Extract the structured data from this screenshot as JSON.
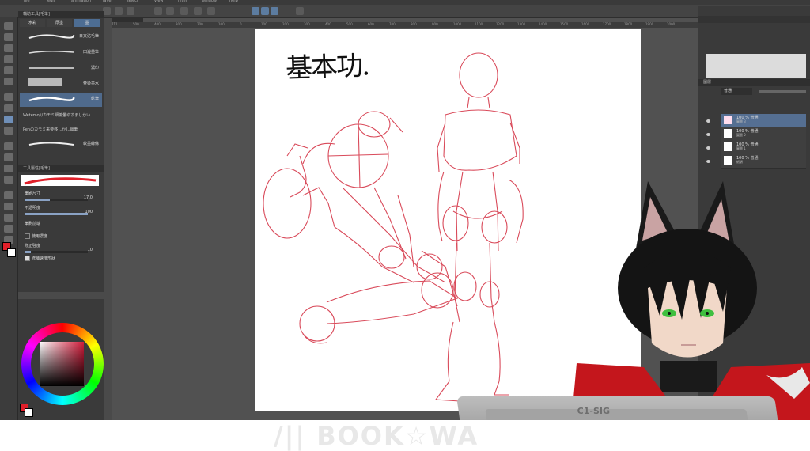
{
  "menu": {
    "items": [
      "file",
      "edit",
      "animation",
      "layer",
      "select",
      "view",
      "filter",
      "window",
      "help"
    ]
  },
  "subtool": {
    "header": "輔助工具[毛筆]",
    "tabs": [
      "水彩",
      "厚塗",
      "墨"
    ],
    "brushes": [
      {
        "label": "日文沾毛筆"
      },
      {
        "label": "田邊墨筆"
      },
      {
        "label": "濃印"
      },
      {
        "label": "暈染墨水"
      },
      {
        "label": "乾筆"
      },
      {
        "label": "Wetemoji毛筆 (細擦暈)",
        "long": "Wetemoji/カモミ細擦暈ゆすましかい"
      },
      {
        "label": "Pen",
        "long": "Penのカモミ来要移しかし細筆"
      },
      {
        "label": "軟墨線條"
      }
    ]
  },
  "toolprop": {
    "header": "工具屬性[毛筆]",
    "brush_size_label": "筆刷尺寸",
    "brush_size_value": "17.0",
    "opacity_label": "不透明度",
    "opacity_value": "100",
    "brush_shape_label": "筆刷前端",
    "anti_alias_label": "使用濃度",
    "stabilize_label": "修正強度",
    "stabilize_value": "10",
    "vector_label": "修補速度形狀"
  },
  "colors": {
    "main": "#e0202a",
    "sub": "#ffffff",
    "accent": "#5c7ca0"
  },
  "ruler": {
    "ticks": [
      "711",
      "500",
      "400",
      "300",
      "200",
      "100",
      "0",
      "100",
      "200",
      "300",
      "400",
      "500",
      "600",
      "700",
      "800",
      "900",
      "1000",
      "1100",
      "1200",
      "1300",
      "1400",
      "1500",
      "1600",
      "1700",
      "1800",
      "1900",
      "2000"
    ]
  },
  "canvas": {
    "title_text": "基本功."
  },
  "layers": {
    "header": "圖層",
    "blend": "普通",
    "items": [
      {
        "name": "100 % 普通",
        "sub": "圖層 3",
        "selected": true
      },
      {
        "name": "100 % 普通",
        "sub": "圖層 2",
        "selected": false
      },
      {
        "name": "100 % 普通",
        "sub": "圖層 1",
        "selected": false
      },
      {
        "name": "100 % 普通",
        "sub": "紙張",
        "selected": false
      }
    ]
  },
  "watermark": "/|| BOOK☆WA",
  "tablet": {
    "brand": "C1-SIG"
  }
}
